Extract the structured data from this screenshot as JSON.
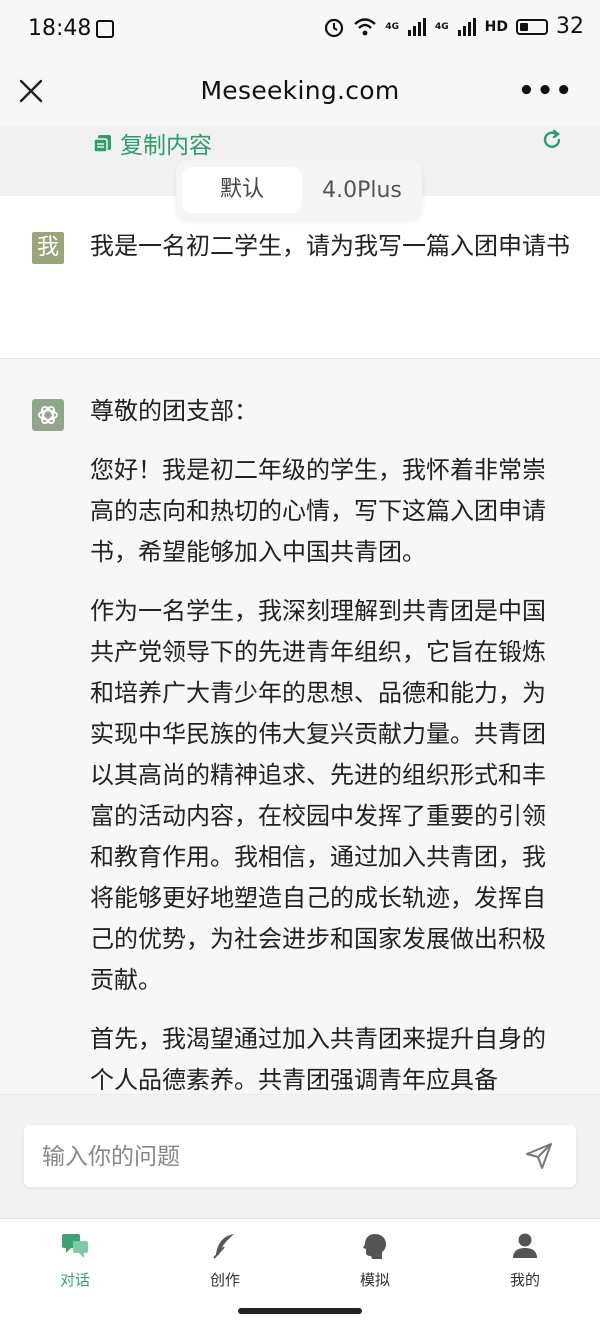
{
  "status_bar": {
    "time": "18:48",
    "signal_label_1": "4G",
    "signal_label_2": "4G",
    "hd_label": "HD",
    "battery": "32"
  },
  "nav": {
    "title": "Meseeking.com"
  },
  "toolbar": {
    "copy_label": "复制内容"
  },
  "mode_toggle": {
    "options": [
      "默认",
      "4.0Plus"
    ],
    "selected": "默认"
  },
  "chat": {
    "user_avatar_text": "我",
    "user_message": "我是一名初二学生，请为我写一篇入团申请书",
    "ai_paragraphs": [
      "尊敬的团支部：",
      "您好！我是初二年级的学生，我怀着非常崇高的志向和热切的心情，写下这篇入团申请书，希望能够加入中国共青团。",
      "作为一名学生，我深刻理解到共青团是中国共产党领导下的先进青年组织，它旨在锻炼和培养广大青少年的思想、品德和能力，为实现中华民族的伟大复兴贡献力量。共青团以其高尚的精神追求、先进的组织形式和丰富的活动内容，在校园中发挥了重要的引领和教育作用。我相信，通过加入共青团，我将能够更好地塑造自己的成长轨迹，发挥自己的优势，为社会进步和国家发展做出积极贡献。",
      "首先，我渴望通过加入共青团来提升自身的个人品德素养。共青团强调青年应具备"
    ]
  },
  "input": {
    "placeholder": "输入你的问题",
    "value": ""
  },
  "tabs": [
    {
      "label": "对话",
      "icon": "chat-icon",
      "active": true
    },
    {
      "label": "创作",
      "icon": "feather-icon",
      "active": false
    },
    {
      "label": "模拟",
      "icon": "head-icon",
      "active": false
    },
    {
      "label": "我的",
      "icon": "person-icon",
      "active": false
    }
  ],
  "colors": {
    "accent": "#3ba374",
    "link": "#2f9c6b",
    "user_avatar": "#9aa57a",
    "ai_avatar": "#8fa68a"
  }
}
